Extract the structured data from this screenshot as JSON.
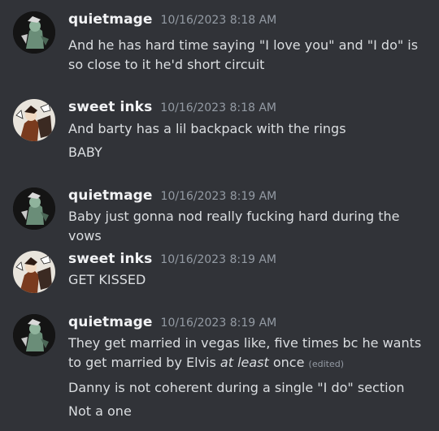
{
  "messages": [
    {
      "author": "quietmage",
      "time": "10/16/2023 8:18 AM",
      "lines": [
        "And he has hard time saying \"I love you\" and \"I do\" is so close to it he'd short circuit"
      ]
    },
    {
      "author": "sweet inks",
      "time": "10/16/2023 8:18 AM",
      "lines": [
        "And barty has a lil backpack with the rings",
        "BABY"
      ]
    },
    {
      "author": "quietmage",
      "time": "10/16/2023 8:19 AM",
      "lines": [
        "Baby just gonna nod really fucking hard during the vows"
      ]
    },
    {
      "author": "sweet inks",
      "time": "10/16/2023 8:19 AM",
      "lines": [
        "GET KISSED"
      ]
    },
    {
      "author": "quietmage",
      "time": "10/16/2023 8:19 AM",
      "lines": [
        {
          "before": "They get married in vegas like, five times bc he wants to get married by Elvis ",
          "emphasis": "at least",
          "after": " once",
          "edited_label": "(edited)"
        },
        "Danny is not coherent during a single \"I do\" section",
        "Not a one"
      ]
    }
  ]
}
